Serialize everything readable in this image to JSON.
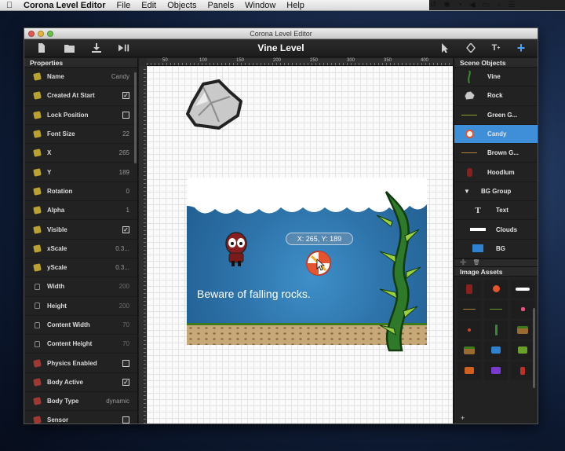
{
  "menubar": {
    "apple_icon": "apple-icon",
    "app_name": "Corona Level Editor",
    "menus": [
      "File",
      "Edit",
      "Objects",
      "Panels",
      "Window",
      "Help"
    ]
  },
  "window": {
    "title": "Corona Level Editor",
    "document_title": "Vine Level"
  },
  "properties": {
    "header": "Properties",
    "rows": [
      {
        "label": "Name",
        "value": "Candy",
        "icon": "yellow",
        "type": "text"
      },
      {
        "label": "Created At Start",
        "value": "✓",
        "icon": "yellow",
        "type": "check"
      },
      {
        "label": "Lock Position",
        "value": "",
        "icon": "yellow",
        "type": "check"
      },
      {
        "label": "Font Size",
        "value": "22",
        "icon": "yellow",
        "type": "text"
      },
      {
        "label": "X",
        "value": "265",
        "icon": "yellow",
        "type": "text"
      },
      {
        "label": "Y",
        "value": "189",
        "icon": "yellow",
        "type": "text"
      },
      {
        "label": "Rotation",
        "value": "0",
        "icon": "yellow",
        "type": "text"
      },
      {
        "label": "Alpha",
        "value": "1",
        "icon": "yellow",
        "type": "text"
      },
      {
        "label": "Visible",
        "value": "✓",
        "icon": "yellow",
        "type": "check"
      },
      {
        "label": "xScale",
        "value": "0.3...",
        "icon": "yellow",
        "type": "text"
      },
      {
        "label": "yScale",
        "value": "0.3...",
        "icon": "yellow",
        "type": "text"
      },
      {
        "label": "Width",
        "value": "200",
        "icon": "lock",
        "type": "text"
      },
      {
        "label": "Height",
        "value": "200",
        "icon": "lock",
        "type": "text"
      },
      {
        "label": "Content Width",
        "value": "70",
        "icon": "lock",
        "type": "text"
      },
      {
        "label": "Content Height",
        "value": "70",
        "icon": "lock",
        "type": "text"
      },
      {
        "label": "Physics Enabled",
        "value": "",
        "icon": "red",
        "type": "check"
      },
      {
        "label": "Body Active",
        "value": "✓",
        "icon": "red",
        "type": "check"
      },
      {
        "label": "Body Type",
        "value": "dynamic",
        "icon": "red",
        "type": "text"
      },
      {
        "label": "Sensor",
        "value": "",
        "icon": "red",
        "type": "check"
      }
    ]
  },
  "ruler": {
    "labels": [
      "50",
      "100",
      "150",
      "200",
      "250",
      "300",
      "350",
      "400"
    ]
  },
  "canvas": {
    "tooltip": "X: 265, Y: 189",
    "caption": "Beware of falling rocks."
  },
  "scene_objects": {
    "header": "Scene Objects",
    "items": [
      {
        "label": "Vine",
        "thumb": "vine",
        "selected": false,
        "indent": false
      },
      {
        "label": "Rock",
        "thumb": "rock",
        "selected": false,
        "indent": false
      },
      {
        "label": "Green G...",
        "thumb": "green-line",
        "selected": false,
        "indent": false
      },
      {
        "label": "Candy",
        "thumb": "candy",
        "selected": true,
        "indent": false
      },
      {
        "label": "Brown G...",
        "thumb": "brown-line",
        "selected": false,
        "indent": false
      },
      {
        "label": "Hoodlum",
        "thumb": "hoodlum",
        "selected": false,
        "indent": false
      },
      {
        "label": "BG Group",
        "thumb": "group",
        "selected": false,
        "indent": false
      },
      {
        "label": "Text",
        "thumb": "text",
        "selected": false,
        "indent": true
      },
      {
        "label": "Clouds",
        "thumb": "clouds",
        "selected": false,
        "indent": true
      },
      {
        "label": "BG",
        "thumb": "bg",
        "selected": false,
        "indent": true
      }
    ]
  },
  "image_assets": {
    "header": "Image Assets",
    "add_label": "+"
  },
  "colors": {
    "selection": "#3f8fd8",
    "accent_plus": "#4aa3ff",
    "property_icon_yellow": "#b9a132",
    "property_icon_red": "#9e3a33"
  }
}
